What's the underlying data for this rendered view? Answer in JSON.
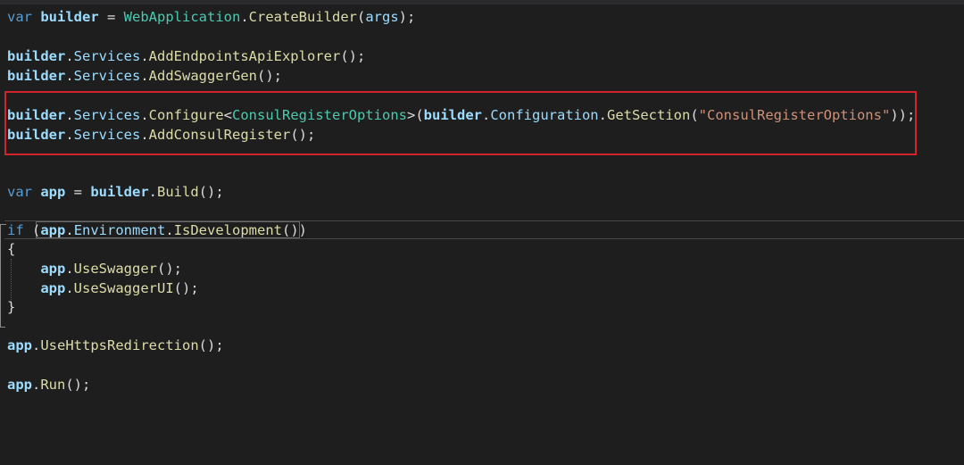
{
  "code": {
    "lines": [
      [
        {
          "t": "var",
          "c": "kw"
        },
        {
          "t": " ",
          "c": "plain"
        },
        {
          "t": "builder",
          "c": "var"
        },
        {
          "t": " = ",
          "c": "punc"
        },
        {
          "t": "WebApplication",
          "c": "type"
        },
        {
          "t": ".",
          "c": "punc"
        },
        {
          "t": "CreateBuilder",
          "c": "meth"
        },
        {
          "t": "(",
          "c": "punc"
        },
        {
          "t": "args",
          "c": "prop"
        },
        {
          "t": ");",
          "c": "punc"
        }
      ],
      [
        {
          "t": "builder",
          "c": "var"
        },
        {
          "t": ".",
          "c": "punc"
        },
        {
          "t": "Services",
          "c": "prop"
        },
        {
          "t": ".",
          "c": "punc"
        },
        {
          "t": "AddEndpointsApiExplorer",
          "c": "meth"
        },
        {
          "t": "();",
          "c": "punc"
        }
      ],
      [
        {
          "t": "builder",
          "c": "var"
        },
        {
          "t": ".",
          "c": "punc"
        },
        {
          "t": "Services",
          "c": "prop"
        },
        {
          "t": ".",
          "c": "punc"
        },
        {
          "t": "AddSwaggerGen",
          "c": "meth"
        },
        {
          "t": "();",
          "c": "punc"
        }
      ],
      [
        {
          "t": "builder",
          "c": "var"
        },
        {
          "t": ".",
          "c": "punc"
        },
        {
          "t": "Services",
          "c": "prop"
        },
        {
          "t": ".",
          "c": "punc"
        },
        {
          "t": "Configure",
          "c": "meth"
        },
        {
          "t": "<",
          "c": "punc"
        },
        {
          "t": "ConsulRegisterOptions",
          "c": "type"
        },
        {
          "t": ">(",
          "c": "punc"
        },
        {
          "t": "builder",
          "c": "var"
        },
        {
          "t": ".",
          "c": "punc"
        },
        {
          "t": "Configuration",
          "c": "prop"
        },
        {
          "t": ".",
          "c": "punc"
        },
        {
          "t": "GetSection",
          "c": "meth"
        },
        {
          "t": "(",
          "c": "punc"
        },
        {
          "t": "\"ConsulRegisterOptions\"",
          "c": "str"
        },
        {
          "t": "));",
          "c": "punc"
        }
      ],
      [
        {
          "t": "builder",
          "c": "var"
        },
        {
          "t": ".",
          "c": "punc"
        },
        {
          "t": "Services",
          "c": "prop"
        },
        {
          "t": ".",
          "c": "punc"
        },
        {
          "t": "AddConsulRegister",
          "c": "meth"
        },
        {
          "t": "();",
          "c": "punc"
        }
      ],
      [
        {
          "t": "var",
          "c": "kw"
        },
        {
          "t": " ",
          "c": "plain"
        },
        {
          "t": "app",
          "c": "var"
        },
        {
          "t": " = ",
          "c": "punc"
        },
        {
          "t": "builder",
          "c": "var"
        },
        {
          "t": ".",
          "c": "punc"
        },
        {
          "t": "Build",
          "c": "meth"
        },
        {
          "t": "();",
          "c": "punc"
        }
      ],
      [
        {
          "t": "if",
          "c": "kw"
        },
        {
          "t": " (",
          "c": "punc"
        },
        {
          "t": "app",
          "c": "var"
        },
        {
          "t": ".",
          "c": "punc"
        },
        {
          "t": "Environment",
          "c": "prop"
        },
        {
          "t": ".",
          "c": "punc"
        },
        {
          "t": "IsDevelopment",
          "c": "meth"
        },
        {
          "t": "())",
          "c": "punc"
        }
      ],
      [
        {
          "t": "{",
          "c": "punc"
        }
      ],
      [
        {
          "t": "    ",
          "c": "plain"
        },
        {
          "t": "app",
          "c": "var"
        },
        {
          "t": ".",
          "c": "punc"
        },
        {
          "t": "UseSwagger",
          "c": "meth"
        },
        {
          "t": "();",
          "c": "punc"
        }
      ],
      [
        {
          "t": "    ",
          "c": "plain"
        },
        {
          "t": "app",
          "c": "var"
        },
        {
          "t": ".",
          "c": "punc"
        },
        {
          "t": "UseSwaggerUI",
          "c": "meth"
        },
        {
          "t": "();",
          "c": "punc"
        }
      ],
      [
        {
          "t": "}",
          "c": "punc"
        }
      ],
      [
        {
          "t": "app",
          "c": "var"
        },
        {
          "t": ".",
          "c": "punc"
        },
        {
          "t": "UseHttpsRedirection",
          "c": "meth"
        },
        {
          "t": "();",
          "c": "punc"
        }
      ],
      [
        {
          "t": "app",
          "c": "var"
        },
        {
          "t": ".",
          "c": "punc"
        },
        {
          "t": "Run",
          "c": "meth"
        },
        {
          "t": "();",
          "c": "punc"
        }
      ]
    ]
  },
  "colors": {
    "background": "#1e1e1e",
    "keyword": "#569cd6",
    "variable": "#9cdcfe",
    "type": "#4ec9b0",
    "method": "#dcdcaa",
    "string": "#ce9178",
    "highlight_box": "#d1232a"
  }
}
